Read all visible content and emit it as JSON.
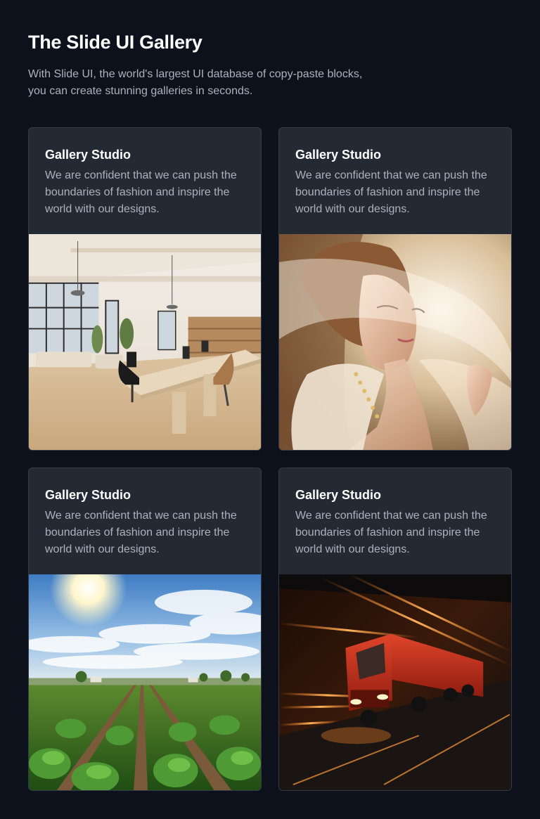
{
  "header": {
    "title": "The Slide UI Gallery",
    "subtitle_line1": "With Slide UI, the world's largest UI database of copy-paste blocks,",
    "subtitle_line2": "you can create stunning galleries in seconds."
  },
  "cards": [
    {
      "title": "Gallery Studio",
      "text": "We are confident that we can push the boundaries of fashion and inspire the world with our designs.",
      "image": "office-interior-image"
    },
    {
      "title": "Gallery Studio",
      "text": "We are confident that we can push the boundaries of fashion and inspire the world with our designs.",
      "image": "veiled-woman-portrait-image"
    },
    {
      "title": "Gallery Studio",
      "text": "We are confident that we can push the boundaries of fashion and inspire the world with our designs.",
      "image": "crop-field-landscape-image"
    },
    {
      "title": "Gallery Studio",
      "text": "We are confident that we can push the boundaries of fashion and inspire the world with our designs.",
      "image": "red-truck-tunnel-image"
    }
  ]
}
